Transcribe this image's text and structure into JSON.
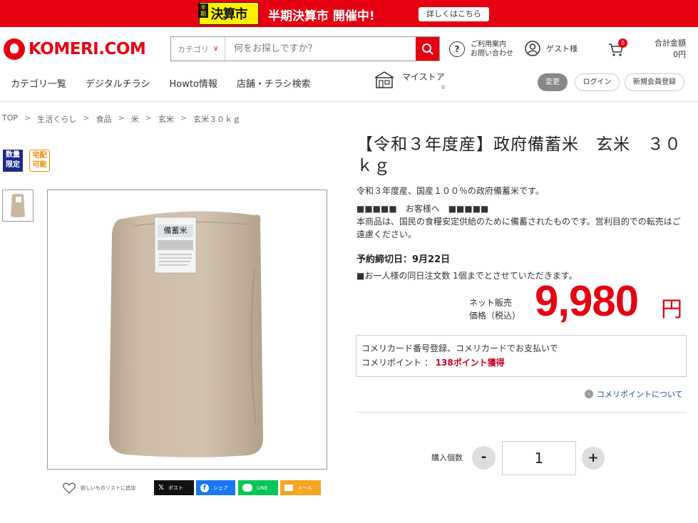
{
  "banner": {
    "logo_main": "決算市",
    "logo_sub": "半期",
    "headline": "半期決算市 開催中!",
    "button": "詳しくはこちら",
    "color": "#e60012"
  },
  "header": {
    "logo": "KOMERI.COM",
    "search": {
      "category": "カテゴリ",
      "placeholder": "何をお探しですか？"
    },
    "help_line1": "ご利用案内",
    "help_line2": "お問い合わせ",
    "guest": "ゲスト様",
    "cart_count": "0",
    "total_label": "合計金額",
    "total_value": "0円"
  },
  "nav": {
    "items": [
      "カテゴリ一覧",
      "デジタルチラシ",
      "Howto情報",
      "店舗・チラシ検索"
    ],
    "mystore": "マイストア",
    "change": "変更",
    "login": "ログイン",
    "register": "新規会員登録"
  },
  "breadcrumb": [
    "TOP",
    "生活くらし",
    "食品",
    "米",
    "玄米",
    "玄米３０ｋｇ"
  ],
  "badges": {
    "limited": [
      "数量",
      "限定"
    ],
    "delivery": [
      "宅配",
      "可能"
    ]
  },
  "product": {
    "title": "【令和３年度産】政府備蓄米　玄米　３０ｋｇ",
    "desc1": "令和３年度産、国産１００％の政府備蓄米です。",
    "desc2": "■■■■■　お客様へ　■■■■■",
    "desc3": "本商品は、国民の食糧安定供給のために備蓄されたものです。営利目的での転売はご遠慮ください。",
    "deadline": "予約締切日：9月22日",
    "limit": "■お一人様の同日注文数 1個までとさせていただきます。",
    "price_label1": "ネット販売",
    "price_label2": "価格（税込）",
    "price": "9,980",
    "yen": "円",
    "point_line1": "コメリカード番号登録、コメリカードでお支払いで",
    "point_prefix": "コメリポイント ： ",
    "point_value": "138ポイント獲得",
    "point_link": "コメリポイントについて",
    "qty_label": "購入個数",
    "qty_value": "1",
    "bag_label": "備蓄米"
  },
  "share": {
    "wishlist": "欲しいものリストに追加",
    "x": "ポスト",
    "facebook": "シェア",
    "line": "LINE",
    "mail": "メール"
  }
}
